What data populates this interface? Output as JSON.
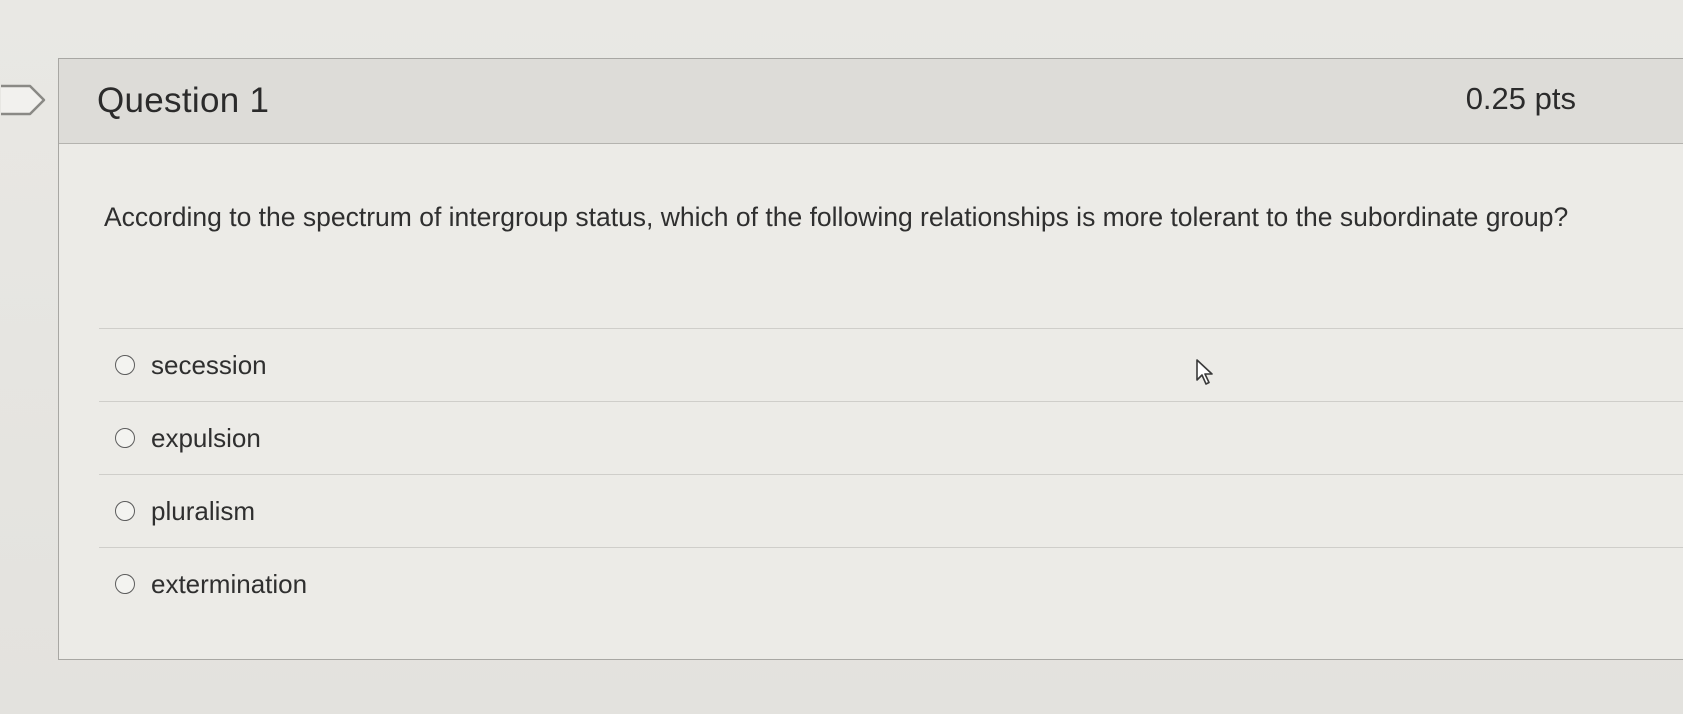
{
  "question": {
    "title": "Question 1",
    "points": "0.25 pts",
    "text": "According to the spectrum of intergroup status, which of the following relationships is more tolerant to the subordinate group?"
  },
  "answers": [
    {
      "label": "secession"
    },
    {
      "label": "expulsion"
    },
    {
      "label": "pluralism"
    },
    {
      "label": "extermination"
    }
  ],
  "icons": {
    "flag": "flag-question-icon",
    "cursor": "mouse-pointer-icon",
    "radio": "radio-button-icon"
  }
}
